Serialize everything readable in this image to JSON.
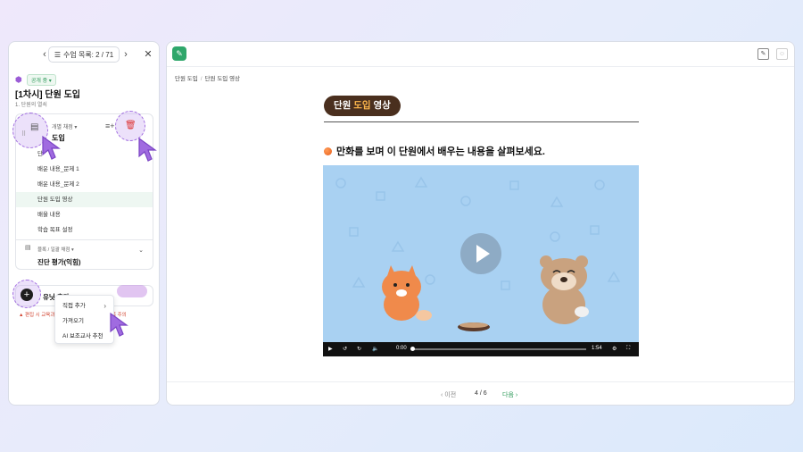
{
  "left": {
    "nav": {
      "prev": "‹",
      "next": "›",
      "close": "✕",
      "list_label": "수업 목록: 2 / 71"
    },
    "public_tag": "공개 중",
    "title": "[1차시] 단원 도입",
    "subtitle": "1. 단원의 열쇠",
    "lesson_card": {
      "header_small": "개별 채점",
      "header_title": "도입",
      "items": [
        {
          "label": "단"
        },
        {
          "label": "배운 내용_문제 1"
        },
        {
          "label": "배운 내용_문제 2"
        },
        {
          "label": "단원 도입 영상",
          "selected": true
        },
        {
          "label": "배울 내용"
        },
        {
          "label": "학습 목표 설정"
        }
      ],
      "section_small": "블록 / 일괄 채점",
      "section_title": "진단 평가(익힘)"
    },
    "add_label": "유닛 추가",
    "warning": "▲ 편집 시 교육과정·          의 내용을 포함하지 않도록 주의",
    "menu": {
      "items": [
        "직접 추가",
        "가져오기",
        "AI 보조교사 추천"
      ]
    }
  },
  "right": {
    "breadcrumb": [
      "단원 도입",
      "단원 도입 영상"
    ],
    "banner_part1": "단원 ",
    "banner_highlight": "도입",
    "banner_part2": " 영상",
    "question": "만화를 보며 이 단원에서 배우는 내용을 살펴보세요.",
    "video": {
      "current_time": "0:00",
      "duration": "1:54",
      "progress": 0.0
    },
    "footer": {
      "prev": "이전",
      "page": "4 / 6",
      "next": "다음"
    }
  },
  "colors": {
    "accent": "#2e9a5a",
    "highlight": "#a06be0",
    "banner_bg": "#4a2f1e"
  },
  "icons": [
    "chevron-left-icon",
    "chevron-right-icon",
    "list-icon",
    "close-icon",
    "cube-icon",
    "sort-icon",
    "trash-icon",
    "drag-handle-icon",
    "document-icon",
    "plus-icon",
    "play-icon",
    "logo-icon",
    "memo-icon",
    "person-icon"
  ]
}
